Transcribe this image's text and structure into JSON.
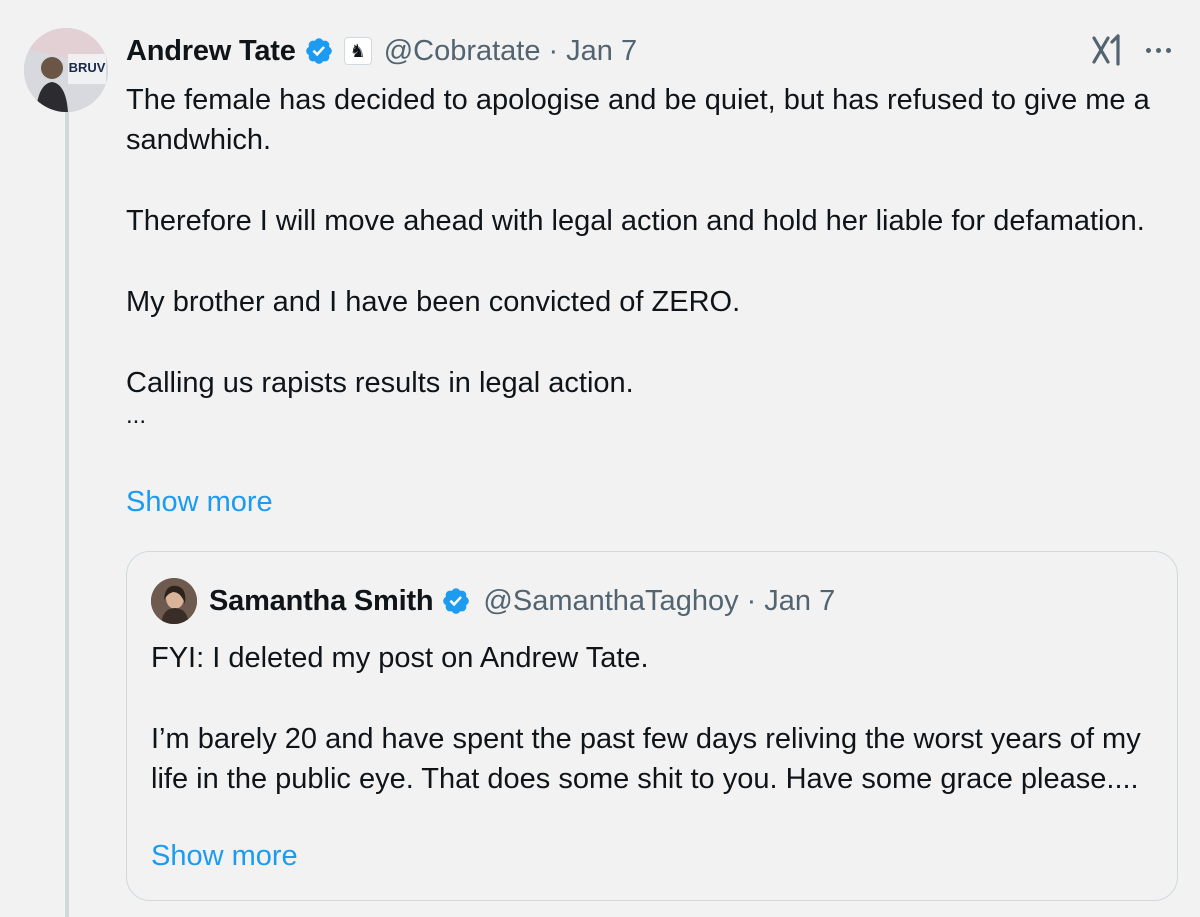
{
  "tweet": {
    "author": {
      "name": "Andrew Tate",
      "handle": "@Cobratate",
      "avatar_text": "BRUV",
      "verified": true,
      "affiliate_badge_icon": "chess-knight-icon"
    },
    "separator": "·",
    "date": "Jan 7",
    "paragraphs": [
      "The female has decided to apologise and be quiet, but has refused to give me a sandwhich.",
      "Therefore I will move ahead with legal action and hold her liable for defamation.",
      "My brother and I have been convicted of ZERO.",
      "Calling us rapists results in legal action."
    ],
    "truncation": "...",
    "show_more": "Show more",
    "accent_color": "#1d9bf0",
    "verified_color": "#1d9bf0"
  },
  "quote": {
    "author": {
      "name": "Samantha Smith",
      "handle": "@SamanthaTaghoy",
      "verified": true
    },
    "separator": "·",
    "date": "Jan 7",
    "paragraphs": [
      "FYI: I deleted my post on Andrew Tate.",
      "I’m barely 20 and have spent the past few days reliving the worst years of my life in the public eye. That does some shit to you. Have some grace please...."
    ],
    "show_more": "Show more"
  },
  "icons": {
    "grok": "grok-icon",
    "more": "more-options-icon"
  }
}
